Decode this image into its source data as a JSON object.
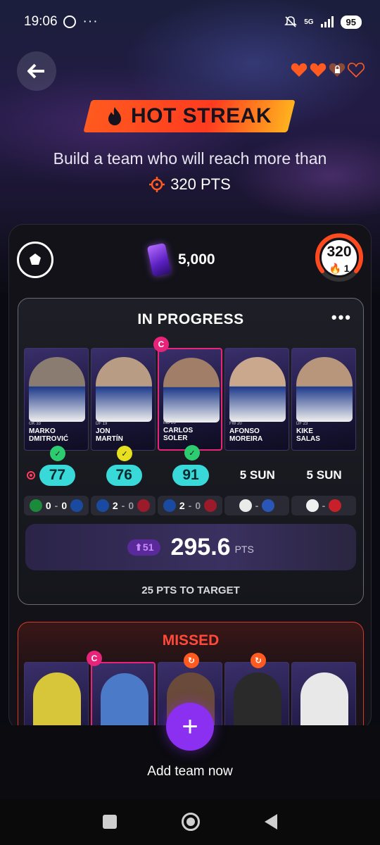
{
  "status_bar": {
    "time": "19:06",
    "dots": "···",
    "network": "5G",
    "battery": "95"
  },
  "header": {
    "title": "HOT STREAK",
    "subtitle": "Build a team who will reach more than",
    "target": "320 PTS"
  },
  "hearts": {
    "full": 2,
    "locked": 1,
    "empty": 1
  },
  "panel": {
    "credits": "5,000",
    "gauge_value": "320",
    "gauge_sub": "1"
  },
  "team": {
    "status": "IN PROGRESS",
    "more": "•••",
    "players": [
      {
        "name1": "MARKO",
        "name2": "DMITROVIĆ",
        "meta": "GK 33",
        "score": "77",
        "badge_color": "#2ecc71",
        "photo": "#8a7c70"
      },
      {
        "name1": "JON",
        "name2": "MARTÍN",
        "meta": "DF 19",
        "score": "76",
        "badge_color": "#e6e020",
        "photo": "#b89d84"
      },
      {
        "name1": "CARLOS",
        "name2": "SOLER",
        "meta": "MD 26",
        "score": "91",
        "badge_color": "#2ecc71",
        "photo": "#a07e68"
      },
      {
        "name1": "AFONSO",
        "name2": "MOREIRA",
        "meta": "FW 20",
        "kickoff": "5 SUN",
        "photo": "#c9a88d"
      },
      {
        "name1": "KIKE",
        "name2": "SALAS",
        "meta": "DF 23",
        "kickoff": "5 SUN",
        "photo": "#b8967c"
      }
    ],
    "matches": [
      {
        "home": "0",
        "away": "0",
        "home_color": "#1b8a3a",
        "away_color": "#1a4aa0",
        "live": true
      },
      {
        "home": "2",
        "away": "0",
        "home_color": "#1a4aa0",
        "away_color": "#9b1b2a",
        "live": false
      },
      {
        "home": "2",
        "away": "0",
        "home_color": "#1a4aa0",
        "away_color": "#9b1b2a",
        "live": false
      },
      {
        "sep": "-",
        "home_color": "#eaeaea",
        "away_color": "#2a56b8"
      },
      {
        "sep": "-",
        "home_color": "#f0f0f0",
        "away_color": "#c8202a"
      }
    ],
    "delta": "51",
    "points": "295.6",
    "points_unit": "PTS",
    "to_target": "25 PTS TO TARGET"
  },
  "missed": {
    "title": "MISSED"
  },
  "add": {
    "label": "Add team now",
    "icon": "+"
  },
  "colors": {
    "accent": "#8b2ff0",
    "streak": "#ff5a1f",
    "score_pill": "#39d9d9",
    "captain": "#e8247a"
  }
}
